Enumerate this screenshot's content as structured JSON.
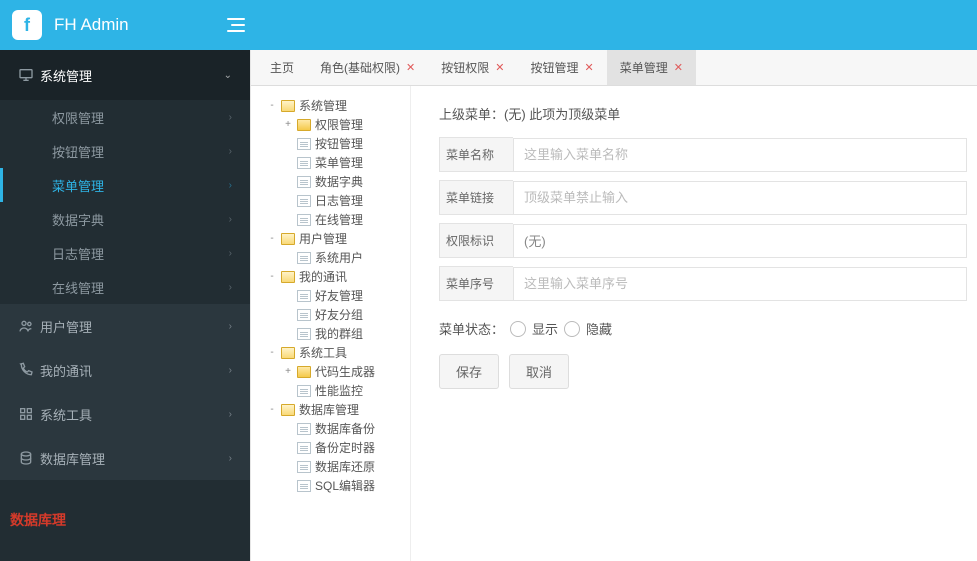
{
  "header": {
    "brand": "FH Admin",
    "logo_letter": "f"
  },
  "sidebar": {
    "sections": [
      {
        "icon": "monitor",
        "label": "系统管理",
        "expanded": true,
        "chev": "v",
        "children": [
          {
            "label": "权限管理"
          },
          {
            "label": "按钮管理"
          },
          {
            "label": "菜单管理",
            "active": true
          },
          {
            "label": "数据字典"
          },
          {
            "label": "日志管理"
          },
          {
            "label": "在线管理"
          }
        ]
      },
      {
        "icon": "users",
        "label": "用户管理",
        "chev": ">"
      },
      {
        "icon": "phone",
        "label": "我的通讯",
        "chev": ">"
      },
      {
        "icon": "grid",
        "label": "系统工具",
        "chev": ">"
      },
      {
        "icon": "db",
        "label": "数据库管理",
        "chev": ">"
      }
    ],
    "overlay": "数据库理"
  },
  "tabs": [
    {
      "label": "主页",
      "closable": false
    },
    {
      "label": "角色(基础权限)",
      "closable": true
    },
    {
      "label": "按钮权限",
      "closable": true
    },
    {
      "label": "按钮管理",
      "closable": true
    },
    {
      "label": "菜单管理",
      "closable": true,
      "active": true
    }
  ],
  "tree": [
    {
      "d": 0,
      "t": "-",
      "i": "folder-open",
      "l": "系统管理"
    },
    {
      "d": 1,
      "t": "+",
      "i": "folder",
      "l": "权限管理"
    },
    {
      "d": 1,
      "t": "",
      "i": "file",
      "l": "按钮管理"
    },
    {
      "d": 1,
      "t": "",
      "i": "file",
      "l": "菜单管理"
    },
    {
      "d": 1,
      "t": "",
      "i": "file",
      "l": "数据字典"
    },
    {
      "d": 1,
      "t": "",
      "i": "file",
      "l": "日志管理"
    },
    {
      "d": 1,
      "t": "",
      "i": "file",
      "l": "在线管理"
    },
    {
      "d": 0,
      "t": "-",
      "i": "folder-open",
      "l": "用户管理"
    },
    {
      "d": 1,
      "t": "",
      "i": "file",
      "l": "系统用户"
    },
    {
      "d": 0,
      "t": "-",
      "i": "folder-open",
      "l": "我的通讯"
    },
    {
      "d": 1,
      "t": "",
      "i": "file",
      "l": "好友管理"
    },
    {
      "d": 1,
      "t": "",
      "i": "file",
      "l": "好友分组"
    },
    {
      "d": 1,
      "t": "",
      "i": "file",
      "l": "我的群组"
    },
    {
      "d": 0,
      "t": "-",
      "i": "folder-open",
      "l": "系统工具"
    },
    {
      "d": 1,
      "t": "+",
      "i": "folder",
      "l": "代码生成器"
    },
    {
      "d": 1,
      "t": "",
      "i": "file",
      "l": "性能监控"
    },
    {
      "d": 0,
      "t": "-",
      "i": "folder-open",
      "l": "数据库管理"
    },
    {
      "d": 1,
      "t": "",
      "i": "file",
      "l": "数据库备份"
    },
    {
      "d": 1,
      "t": "",
      "i": "file",
      "l": "备份定时器"
    },
    {
      "d": 1,
      "t": "",
      "i": "file",
      "l": "数据库还原"
    },
    {
      "d": 1,
      "t": "",
      "i": "file",
      "l": "SQL编辑器"
    }
  ],
  "form": {
    "parent_note": "上级菜单：(无) 此项为顶级菜单",
    "fields": {
      "name_label": "菜单名称",
      "name_ph": "这里输入菜单名称",
      "link_label": "菜单链接",
      "link_ph": "顶级菜单禁止输入",
      "perm_label": "权限标识",
      "perm_value": "(无)",
      "order_label": "菜单序号",
      "order_ph": "这里输入菜单序号"
    },
    "state_label": "菜单状态：",
    "state_show": "显示",
    "state_hide": "隐藏",
    "save": "保存",
    "cancel": "取消"
  }
}
